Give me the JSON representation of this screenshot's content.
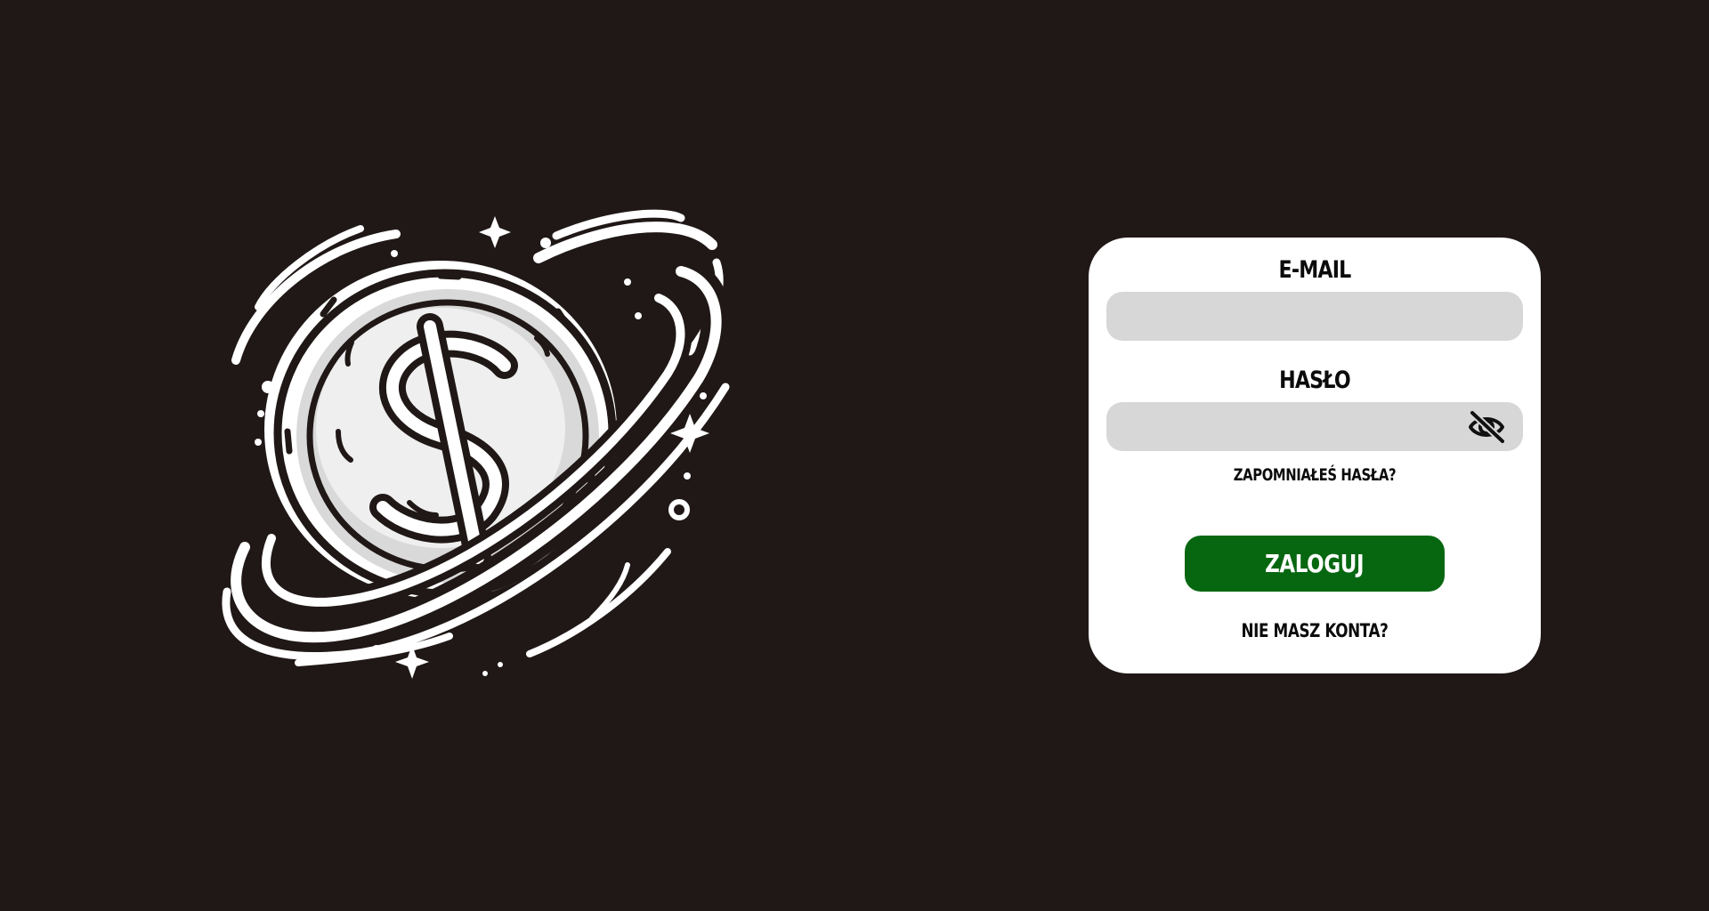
{
  "login": {
    "email_label": "E-MAIL",
    "email_value": "",
    "password_label": "HASŁO",
    "password_value": "",
    "forgot_password": "ZAPOMNIAŁEŚ HASŁA?",
    "submit_label": "ZALOGUJ",
    "register_link": "NIE MASZ KONTA?"
  },
  "icons": {
    "logo": "planet-coin-dollar-logo",
    "password_visibility": "eye-off-icon"
  },
  "colors": {
    "background": "#201817",
    "card": "#ffffff",
    "input": "#d7d7d7",
    "primary_button": "#076711",
    "text": "#0b0b0b"
  }
}
